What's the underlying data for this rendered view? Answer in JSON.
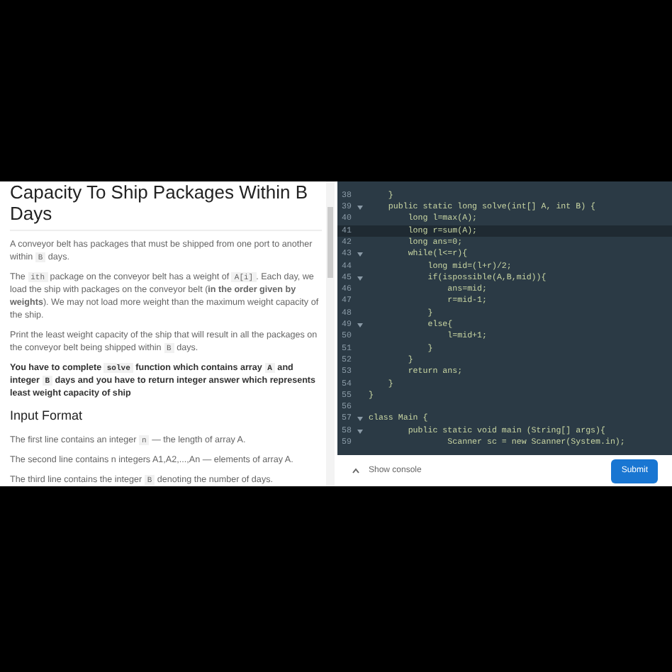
{
  "problem": {
    "title": "Capacity To Ship Packages Within B Days",
    "paragraphs": [
      {
        "bold": false,
        "parts": [
          {
            "t": "A conveyor belt has packages that must be shipped from one port to another within ",
            "code": false
          },
          {
            "t": "B",
            "code": true
          },
          {
            "t": " days.",
            "code": false
          }
        ]
      },
      {
        "bold": false,
        "parts": [
          {
            "t": "The ",
            "code": false
          },
          {
            "t": "ith",
            "code": true
          },
          {
            "t": " package on the conveyor belt has a weight of ",
            "code": false
          },
          {
            "t": "A[i]",
            "code": true
          },
          {
            "t": ". Each day, we load the ship with packages on the conveyor belt (**in the order given by weights**). We may not load more weight than the maximum weight capacity of the ship.",
            "code": false
          }
        ]
      },
      {
        "bold": false,
        "parts": [
          {
            "t": "Print the least weight capacity of the ship that will result in all the packages on the conveyor belt being shipped within ",
            "code": false
          },
          {
            "t": "B",
            "code": true
          },
          {
            "t": " days.",
            "code": false
          }
        ]
      },
      {
        "bold": true,
        "parts": [
          {
            "t": "You have to complete ",
            "code": false
          },
          {
            "t": "solve",
            "code": true
          },
          {
            "t": " function which contains array ",
            "code": false
          },
          {
            "t": "A",
            "code": true
          },
          {
            "t": " and integer ",
            "code": false
          },
          {
            "t": "B",
            "code": true
          },
          {
            "t": " days and you have to return integer answer which represents least weight capacity of ship",
            "code": false
          }
        ]
      }
    ],
    "section_heading": "Input Format",
    "input_lines": [
      {
        "bold": false,
        "parts": [
          {
            "t": "The first line contains an integer ",
            "code": false
          },
          {
            "t": "n",
            "code": true
          },
          {
            "t": " — the length of array A.",
            "code": false
          }
        ]
      },
      {
        "bold": false,
        "parts": [
          {
            "t": "The second line contains n integers A1,A2,...,An — elements of array A.",
            "code": false
          }
        ]
      },
      {
        "bold": false,
        "parts": [
          {
            "t": "The third line contains the integer ",
            "code": false
          },
          {
            "t": "B",
            "code": true
          },
          {
            "t": " denoting the number of days.",
            "code": false
          }
        ]
      }
    ]
  },
  "editor": {
    "lines": [
      {
        "num": "38",
        "text": "    }",
        "fold": false,
        "selected": false
      },
      {
        "num": "39",
        "text": "    public static long solve(int[] A, int B) {",
        "fold": true,
        "selected": false
      },
      {
        "num": "40",
        "text": "        long l=max(A);",
        "fold": false,
        "selected": false
      },
      {
        "num": "41",
        "text": "        long r=sum(A);",
        "fold": false,
        "selected": true
      },
      {
        "num": "42",
        "text": "        long ans=0;",
        "fold": false,
        "selected": false
      },
      {
        "num": "43",
        "text": "        while(l<=r){",
        "fold": true,
        "selected": false
      },
      {
        "num": "44",
        "text": "            long mid=(l+r)/2;",
        "fold": false,
        "selected": false
      },
      {
        "num": "45",
        "text": "            if(ispossible(A,B,mid)){",
        "fold": true,
        "selected": false
      },
      {
        "num": "46",
        "text": "                ans=mid;",
        "fold": false,
        "selected": false
      },
      {
        "num": "47",
        "text": "                r=mid-1;",
        "fold": false,
        "selected": false
      },
      {
        "num": "48",
        "text": "            }",
        "fold": false,
        "selected": false
      },
      {
        "num": "49",
        "text": "            else{",
        "fold": true,
        "selected": false
      },
      {
        "num": "50",
        "text": "                l=mid+1;",
        "fold": false,
        "selected": false
      },
      {
        "num": "51",
        "text": "            }",
        "fold": false,
        "selected": false
      },
      {
        "num": "52",
        "text": "        }",
        "fold": false,
        "selected": false
      },
      {
        "num": "53",
        "text": "        return ans;",
        "fold": false,
        "selected": false
      },
      {
        "num": "54",
        "text": "    }",
        "fold": false,
        "selected": false
      },
      {
        "num": "55",
        "text": "}",
        "fold": false,
        "selected": false
      },
      {
        "num": "56",
        "fold": false,
        "selected": false
      },
      {
        "num": "57",
        "text": "class Main {",
        "fold": true,
        "selected": false
      },
      {
        "num": "58",
        "text": "        public static void main (String[] args){",
        "fold": true,
        "selected": false
      },
      {
        "num": "59",
        "text": "                Scanner sc = new Scanner(System.in);",
        "fold": false,
        "selected": false
      }
    ]
  },
  "footer": {
    "console_toggle": "Show console",
    "submit": "Submit"
  }
}
